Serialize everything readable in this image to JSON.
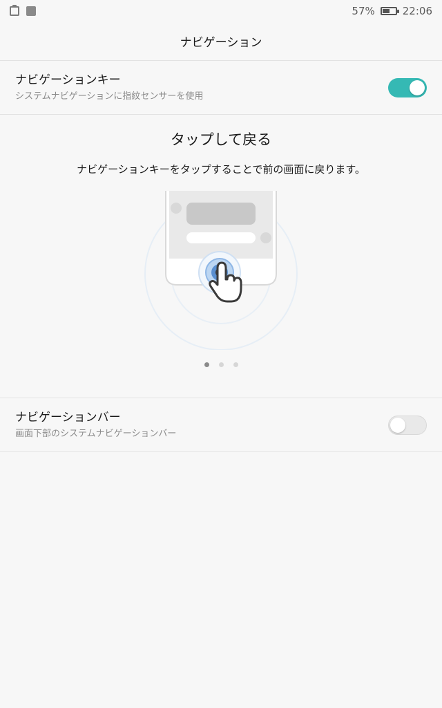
{
  "status_bar": {
    "battery_percent_text": "57%",
    "battery_level": 0.57,
    "time": "22:06",
    "left_icons": [
      "clipboard-icon",
      "image-notification-icon"
    ]
  },
  "header": {
    "title": "ナビゲーション"
  },
  "nav_key": {
    "title": "ナビゲーションキー",
    "subtitle": "システムナビゲーションに指紋センサーを使用",
    "enabled": true
  },
  "tutorial": {
    "title": "タップして戻る",
    "description": "ナビゲーションキーをタップすることで前の画面に戻ります。",
    "page_count": 3,
    "active_page": 1
  },
  "nav_bar": {
    "title": "ナビゲーションバー",
    "subtitle": "画面下部のシステムナビゲーションバー",
    "enabled": false
  },
  "colors": {
    "accent": "#35b9b4",
    "background": "#f7f7f7",
    "ripple": "#4a90d9"
  }
}
